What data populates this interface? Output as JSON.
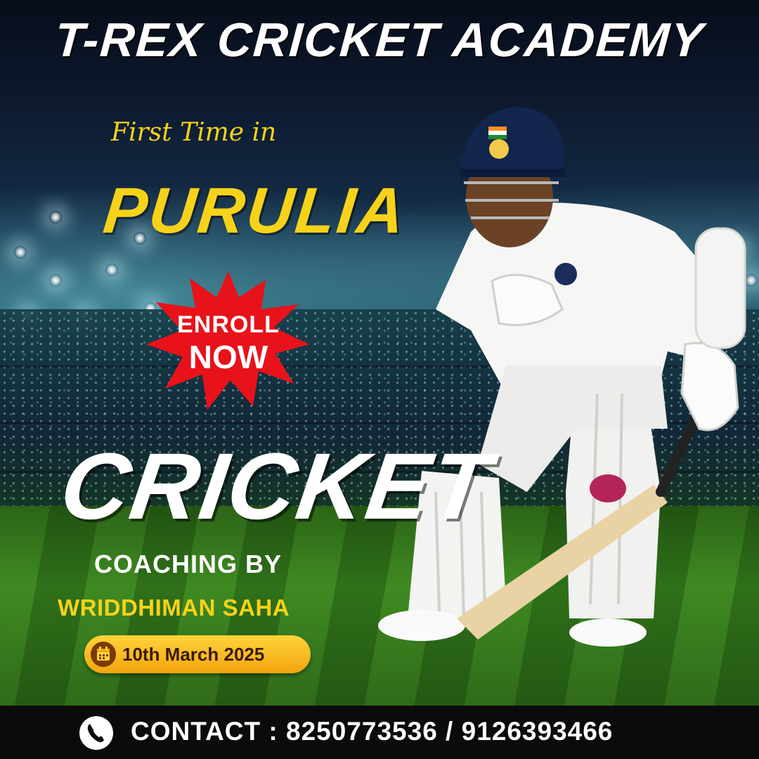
{
  "header": {
    "title": "T-REX CRICKET ACADEMY",
    "subtitle": "First Time in",
    "location": "PURULIA"
  },
  "badge": {
    "line1": "ENROLL",
    "line2": "NOW",
    "color": "#e8121b",
    "icon": "starburst-badge"
  },
  "main": {
    "headline": "CRICKET",
    "coaching_label": "COACHING BY",
    "coach_name": "WRIDDHIMAN SAHA"
  },
  "date_pill": {
    "icon": "calendar-icon",
    "date": "10th March 2025"
  },
  "footer": {
    "icon": "phone-icon",
    "contact_text": "CONTACT : 8250773536 / 9126393466"
  },
  "colors": {
    "accent_yellow": "#f7d21a",
    "badge_red": "#e8121b",
    "title_white": "#ffffff",
    "footer_bg": "#0b0b0b"
  }
}
